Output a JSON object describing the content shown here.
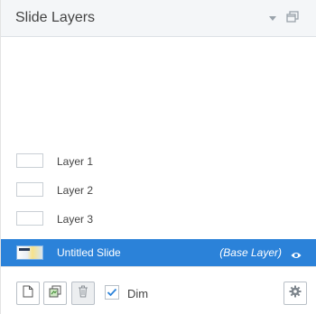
{
  "header": {
    "title": "Slide Layers",
    "dropdown_icon": "chevron-down-icon",
    "popout_icon": "popout-window-icon"
  },
  "layers": [
    {
      "label": "Layer 1"
    },
    {
      "label": "Layer 2"
    },
    {
      "label": "Layer 3"
    }
  ],
  "base_layer": {
    "label": "Untitled Slide",
    "tag": "(Base Layer)",
    "visibility_icon": "eye-icon",
    "selected_color": "#2b82d9"
  },
  "footer": {
    "new_layer_icon": "new-document-icon",
    "duplicate_layer_icon": "duplicate-icon",
    "delete_layer_icon": "trash-icon",
    "dim_label": "Dim",
    "dim_checked": true,
    "settings_icon": "gear-icon"
  }
}
